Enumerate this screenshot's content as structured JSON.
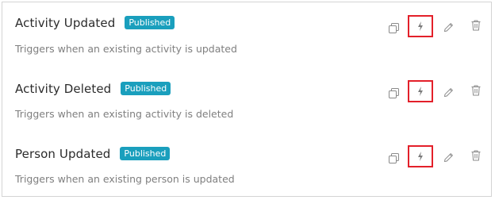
{
  "status_label": "Published",
  "triggers": [
    {
      "title": "Activity Updated",
      "status": "Published",
      "description": "Triggers when an existing activity is updated"
    },
    {
      "title": "Activity Deleted",
      "status": "Published",
      "description": "Triggers when an existing activity is deleted"
    },
    {
      "title": "Person Updated",
      "status": "Published",
      "description": "Triggers when an existing person is updated"
    }
  ],
  "icons": {
    "copy": "copy-icon",
    "trigger": "lightning-icon",
    "edit": "pencil-icon",
    "delete": "trash-icon"
  },
  "colors": {
    "badge": "#1a9fbd",
    "highlight": "#e3202a",
    "icon": "#8a8a8a",
    "title": "#2b2b2b",
    "description": "#7f7f7f",
    "border": "#d4d4d4"
  }
}
